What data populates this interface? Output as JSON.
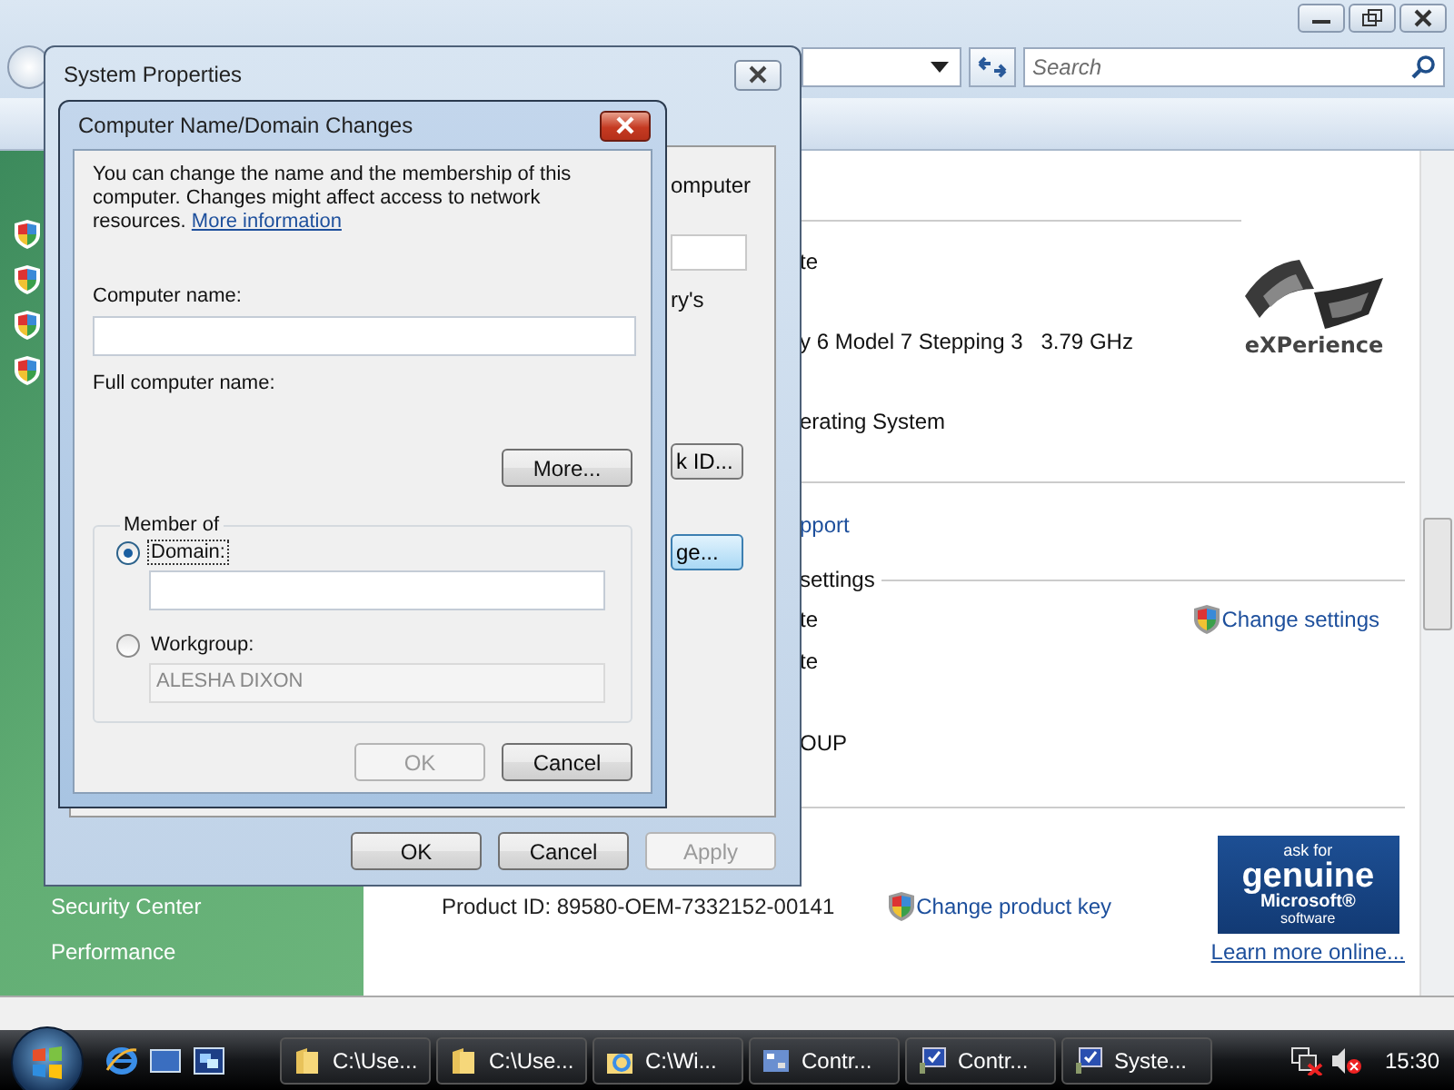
{
  "explorer": {
    "search": {
      "placeholder": "Search"
    },
    "sidebar": {
      "shield_count_items": [
        {
          "kind": "shield"
        },
        {
          "kind": "shield"
        },
        {
          "kind": "shield"
        },
        {
          "kind": "shield"
        }
      ],
      "items": [
        {
          "label": "Security Center"
        },
        {
          "label": "Performance"
        }
      ]
    },
    "content": {
      "top_rows": [
        "te",
        "y 6 Model 7 Stepping 3   3.79 GHz",
        "erating System"
      ],
      "support_link": "pport",
      "section_header": "settings",
      "settings_rows": [
        "te",
        "te",
        "",
        "OUP"
      ],
      "change_settings": "Change settings",
      "product_id": "Product ID: 89580-OEM-7332152-00141",
      "change_product_key": "Change product key",
      "experience_logo": "eXPerience",
      "genuine": [
        "ask for",
        "genuine",
        "Microsoft®",
        "software"
      ],
      "learn_more": "Learn more online..."
    }
  },
  "system_properties": {
    "title": "System Properties",
    "fragments": [
      {
        "kind": "text",
        "text": "omputer"
      },
      {
        "kind": "field"
      },
      {
        "kind": "text",
        "text": "ry's"
      },
      {
        "kind": "button",
        "text": "k ID...",
        "highlighted": false
      },
      {
        "kind": "button",
        "text": "ge...",
        "highlighted": true
      }
    ],
    "buttons": [
      {
        "label": "OK",
        "disabled": false
      },
      {
        "label": "Cancel",
        "disabled": false
      },
      {
        "label": "Apply",
        "disabled": true
      }
    ]
  },
  "dialog": {
    "title": "Computer Name/Domain Changes",
    "description": "You can change the name and the membership of this computer. Changes might affect access to network resources.",
    "more_info_link": "More information",
    "computer_name_label": "Computer name:",
    "full_name_label": "Full computer name:",
    "more_button": "More...",
    "group_label": "Member of",
    "options": [
      {
        "label": "Domain:",
        "selected": true,
        "disabled": false
      },
      {
        "label": "Workgroup:",
        "selected": false,
        "value": "ALESHA DIXON",
        "disabled": true
      }
    ],
    "buttons": [
      {
        "label": "OK",
        "disabled": true
      },
      {
        "label": "Cancel",
        "disabled": false
      }
    ]
  },
  "taskbar": {
    "tasks": [
      {
        "kind": "folder",
        "label": "C:\\Use..."
      },
      {
        "kind": "folder",
        "label": "C:\\Use..."
      },
      {
        "kind": "web-folder",
        "label": "C:\\Wi..."
      },
      {
        "kind": "control-panel",
        "label": "Contr..."
      },
      {
        "kind": "system",
        "label": "Contr..."
      },
      {
        "kind": "system",
        "label": "Syste..."
      }
    ],
    "clock": "15:30"
  }
}
